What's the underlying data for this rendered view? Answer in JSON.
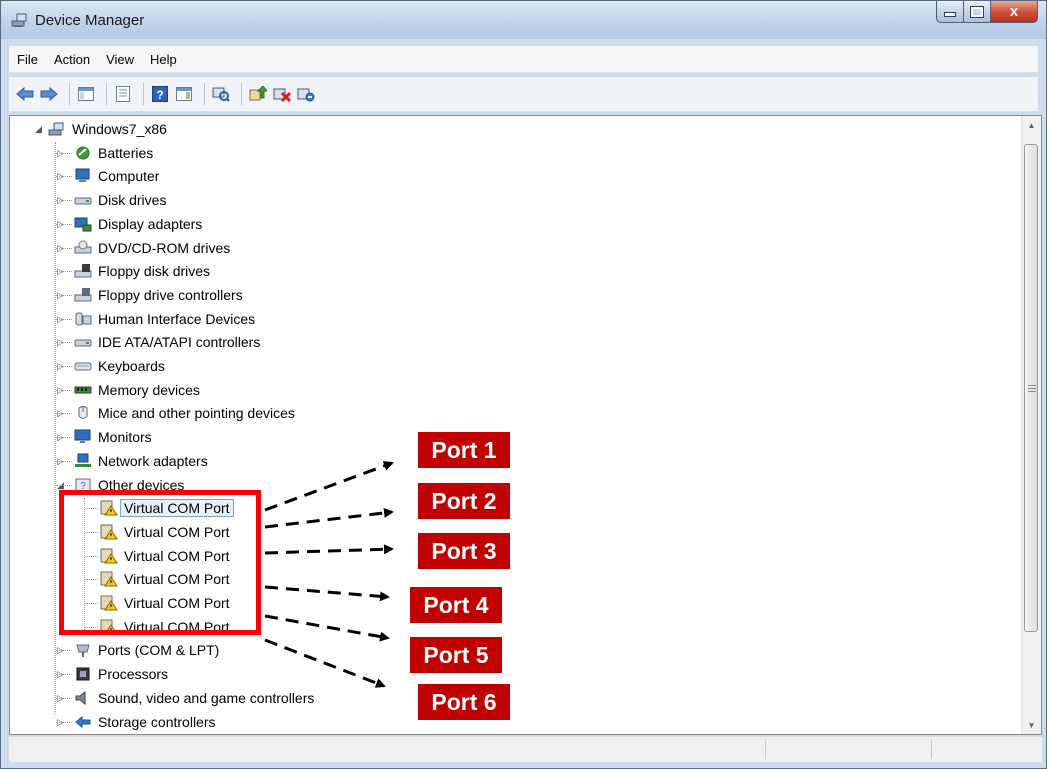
{
  "window": {
    "title": "Device Manager",
    "caption_buttons": {
      "minimize": "minimize",
      "maximize": "maximize",
      "close": "x"
    }
  },
  "menu": [
    "File",
    "Action",
    "View",
    "Help"
  ],
  "toolbar_icons": [
    "back-icon",
    "forward-icon",
    "show-hide-console-tree-icon",
    "properties-icon",
    "help-icon",
    "show-action-pane-icon",
    "scan-hardware-icon",
    "update-driver-icon",
    "disable-device-icon",
    "uninstall-device-icon"
  ],
  "tree": {
    "root": "Windows7_x86",
    "categories": [
      {
        "label": "Batteries",
        "icon": "battery-icon"
      },
      {
        "label": "Computer",
        "icon": "computer-icon"
      },
      {
        "label": "Disk drives",
        "icon": "disk-drive-icon"
      },
      {
        "label": "Display adapters",
        "icon": "display-adapter-icon"
      },
      {
        "label": "DVD/CD-ROM drives",
        "icon": "dvd-drive-icon"
      },
      {
        "label": "Floppy disk drives",
        "icon": "floppy-drive-icon"
      },
      {
        "label": "Floppy drive controllers",
        "icon": "floppy-controller-icon"
      },
      {
        "label": "Human Interface Devices",
        "icon": "hid-icon"
      },
      {
        "label": "IDE ATA/ATAPI controllers",
        "icon": "ide-controller-icon"
      },
      {
        "label": "Keyboards",
        "icon": "keyboard-icon"
      },
      {
        "label": "Memory devices",
        "icon": "memory-icon"
      },
      {
        "label": "Mice and other pointing devices",
        "icon": "mouse-icon"
      },
      {
        "label": "Monitors",
        "icon": "monitor-icon"
      },
      {
        "label": "Network adapters",
        "icon": "network-adapter-icon"
      },
      {
        "label": "Other devices",
        "icon": "unknown-device-icon"
      }
    ],
    "other_devices_children": [
      {
        "label": "Virtual COM Port",
        "icon": "warning-device-icon"
      },
      {
        "label": "Virtual COM Port",
        "icon": "warning-device-icon"
      },
      {
        "label": "Virtual COM Port",
        "icon": "warning-device-icon"
      },
      {
        "label": "Virtual COM Port",
        "icon": "warning-device-icon"
      },
      {
        "label": "Virtual COM Port",
        "icon": "warning-device-icon"
      },
      {
        "label": "Virtual COM Port",
        "icon": "warning-device-icon"
      }
    ],
    "after_categories": [
      {
        "label": "Ports (COM & LPT)",
        "icon": "port-icon"
      },
      {
        "label": "Processors",
        "icon": "processor-icon"
      },
      {
        "label": "Sound, video and game controllers",
        "icon": "sound-icon"
      },
      {
        "label": "Storage controllers",
        "icon": "storage-controller-icon"
      }
    ]
  },
  "annotations": {
    "ports": [
      "Port 1",
      "Port 2",
      "Port 3",
      "Port 4",
      "Port 5",
      "Port 6"
    ],
    "label_color": "#c00000",
    "box_color": "#ff0000"
  }
}
